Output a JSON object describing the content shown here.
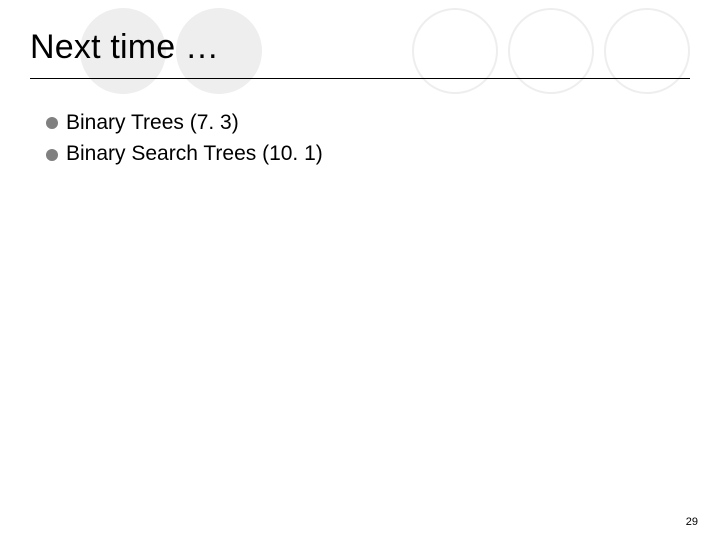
{
  "title": "Next time …",
  "bullets": [
    "Binary Trees (7. 3)",
    "Binary Search Trees (10. 1)"
  ],
  "page_number": "29"
}
